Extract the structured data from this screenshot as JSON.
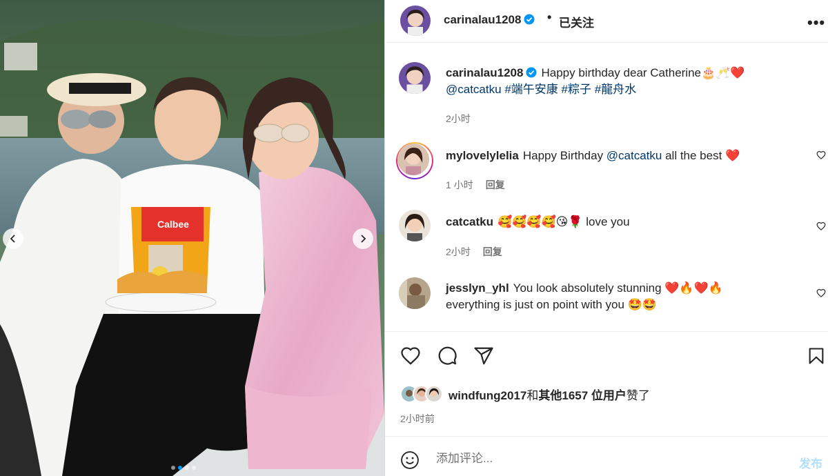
{
  "post": {
    "carousel_count": 4,
    "carousel_active_index": 1,
    "cake_label": "Calbee"
  },
  "header": {
    "username": "carinalau1208",
    "separator": "•",
    "follow_status": "已关注",
    "more": "•••"
  },
  "caption": {
    "username": "carinalau1208",
    "text": "Happy birthday dear Catherine🎂🥂❤️",
    "mention": "@catcatku",
    "hashtags": [
      "#端午安康",
      "#粽子",
      "#龍舟水"
    ],
    "time": "2小时"
  },
  "comments": [
    {
      "username": "mylovelylelia",
      "text_before": "Happy Birthday ",
      "mention": "@catcatku",
      "text_after": " all the best ❤️",
      "time": "1 小时",
      "reply": "回复"
    },
    {
      "username": "catcatku",
      "text": "🥰🥰🥰🥰😘🌹 love you",
      "time": "2小时",
      "reply": "回复"
    },
    {
      "username": "jesslyn_yhl",
      "text": "You look absolutely stunning ❤️🔥❤️🔥",
      "text_line2": "everything is just on point with you 🤩🤩"
    }
  ],
  "likes": {
    "user": "windfung2017",
    "joiner": "和",
    "others": "其他1657 位用户",
    "suffix": "赞了"
  },
  "posted_ago": "2小时前",
  "add_comment": {
    "placeholder": "添加评论...",
    "post_label": "发布"
  },
  "colors": {
    "link": "#00376b",
    "verified": "#0095f6",
    "post_button_disabled": "#b2dffc",
    "secondary_text": "#737373"
  },
  "icons": [
    "chevron-left-icon",
    "chevron-right-icon",
    "verified-icon",
    "more-icon",
    "heart-icon",
    "comment-icon",
    "share-icon",
    "bookmark-icon",
    "emoji-icon"
  ]
}
